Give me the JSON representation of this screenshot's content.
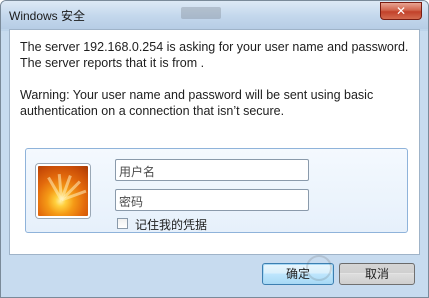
{
  "window": {
    "title": "Windows 安全",
    "close_glyph": "✕"
  },
  "message": {
    "line1": "The server 192.168.0.254 is asking for your user name and password. The server reports that it is from .",
    "line2": "Warning: Your user name and password will be sent using basic authentication on a connection that isn’t secure."
  },
  "credentials": {
    "username_placeholder": "用户名",
    "password_placeholder": "密码",
    "remember_label": "记住我的凭据",
    "remember_checked": false,
    "avatar_icon": "user-tile-flower-icon"
  },
  "buttons": {
    "ok_label": "确定",
    "cancel_label": "取消"
  },
  "colors": {
    "title_bar": "#c3d7ec",
    "close_button": "#c2412a",
    "credential_panel": "#e6f0fb",
    "default_button_border": "#3c7fb1"
  }
}
